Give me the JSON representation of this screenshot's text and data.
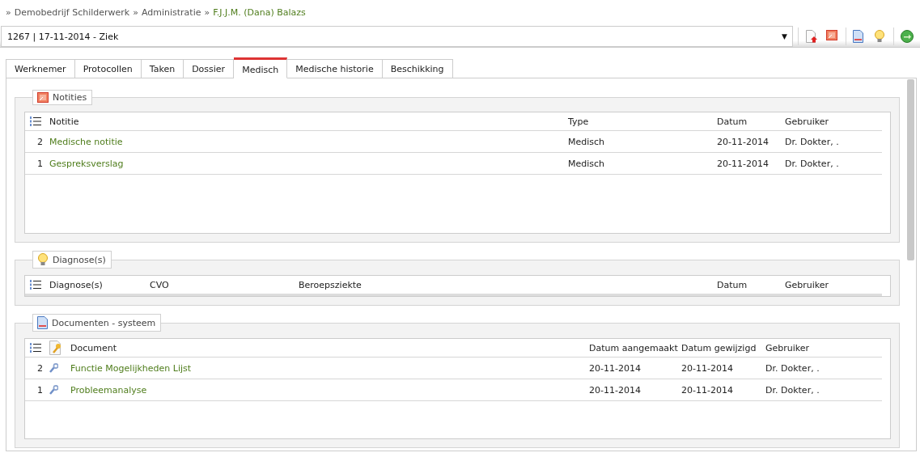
{
  "breadcrumb": {
    "separator": "»",
    "items": [
      {
        "text": "Demobedrijf Schilderwerk",
        "current": false
      },
      {
        "text": "Administratie",
        "current": false
      },
      {
        "text": "F.J.J.M. (Dana) Balazs",
        "current": true
      }
    ]
  },
  "case_select": {
    "value": "1267 | 17-11-2014 - Ziek",
    "arrow": "▼"
  },
  "tabs": [
    {
      "label": "Werknemer",
      "selected": false
    },
    {
      "label": "Protocollen",
      "selected": false
    },
    {
      "label": "Taken",
      "selected": false
    },
    {
      "label": "Dossier",
      "selected": false
    },
    {
      "label": "Medisch",
      "selected": true
    },
    {
      "label": "Medische historie",
      "selected": false
    },
    {
      "label": "Beschikking",
      "selected": false
    }
  ],
  "sections": [
    {
      "kind": "notes",
      "title": "Notities",
      "columns": [
        "Notitie",
        "Type",
        "Datum",
        "Gebruiker"
      ],
      "rows": [
        {
          "number": "2",
          "cells": [
            "Medische notitie",
            "Medisch",
            "20-11-2014",
            "Dr. Dokter, ."
          ]
        },
        {
          "number": "1",
          "cells": [
            "Gespreksverslag",
            "Medisch",
            "20-11-2014",
            "Dr. Dokter, ."
          ]
        }
      ]
    },
    {
      "kind": "diagnoses",
      "title": "Diagnose(s)",
      "columns": [
        "Diagnose(s)",
        "CVO",
        "Beroepsziekte",
        "Datum",
        "Gebruiker"
      ]
    },
    {
      "kind": "documents",
      "title": "Documenten - systeem",
      "columns": [
        "Document",
        "Datum aangemaakt",
        "Datum gewijzigd",
        "Gebruiker"
      ],
      "rows": [
        {
          "number": "2",
          "cells": [
            "Functie Mogelijkheden Lijst",
            "20-11-2014",
            "20-11-2014",
            "Dr. Dokter, ."
          ]
        },
        {
          "number": "1",
          "cells": [
            "Probleemanalyse",
            "20-11-2014",
            "20-11-2014",
            "Dr. Dokter, ."
          ]
        }
      ]
    }
  ]
}
